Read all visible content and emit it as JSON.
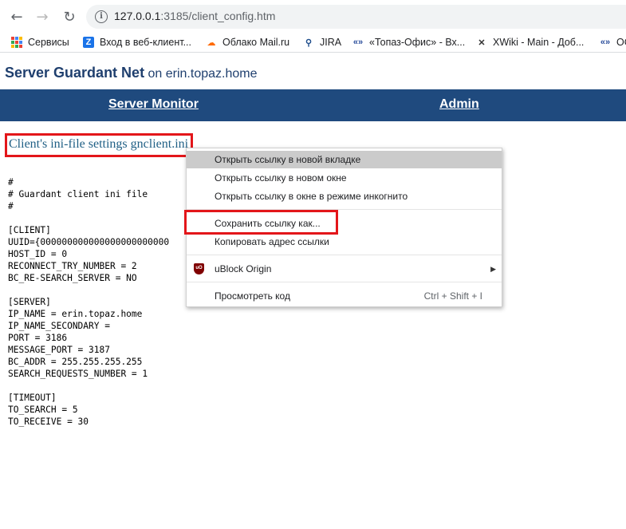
{
  "browser": {
    "url_host": "127.0.0.1",
    "url_rest": ":3185/client_config.htm",
    "bookmarks": [
      {
        "label": "Сервисы"
      },
      {
        "label": "Вход в веб-клиент..."
      },
      {
        "label": "Облако Mail.ru"
      },
      {
        "label": "JIRA"
      },
      {
        "label": "«Топаз-Офис» - Вх..."
      },
      {
        "label": "XWiki - Main - Доб..."
      },
      {
        "label": "ОС"
      }
    ]
  },
  "page": {
    "brand": "Server Guardant Net",
    "host_text": " on erin.topaz.home",
    "nav": {
      "monitor": "Server Monitor",
      "admin": "Admin"
    },
    "config_link": "Client's ini-file settings gnclient.ini",
    "ini_lines": [
      "#",
      "# Guardant client ini file",
      "#",
      "",
      "[CLIENT]",
      "UUID={000000000000000000000000",
      "HOST_ID = 0",
      "RECONNECT_TRY_NUMBER = 2",
      "BC_RE-SEARCH_SERVER = NO",
      "",
      "[SERVER]",
      "IP_NAME = erin.topaz.home",
      "IP_NAME_SECONDARY =",
      "PORT = 3186",
      "MESSAGE_PORT = 3187",
      "BC_ADDR = 255.255.255.255",
      "SEARCH_REQUESTS_NUMBER = 1",
      "",
      "[TIMEOUT]",
      "TO_SEARCH = 5",
      "TO_RECEIVE = 30"
    ]
  },
  "context_menu": {
    "open_new_tab": "Открыть ссылку в новой вкладке",
    "open_new_window": "Открыть ссылку в новом окне",
    "open_incognito": "Открыть ссылку в окне в режиме инкогнито",
    "save_link_as": "Сохранить ссылку как...",
    "copy_link": "Копировать адрес ссылки",
    "ublock": "uBlock Origin",
    "view_source": "Просмотреть код",
    "view_source_shortcut": "Ctrl + Shift + I"
  },
  "colors": {
    "navbar": "#1f4a7e",
    "highlight_box": "#e3161a",
    "menu_hover": "#cbcbcb"
  }
}
